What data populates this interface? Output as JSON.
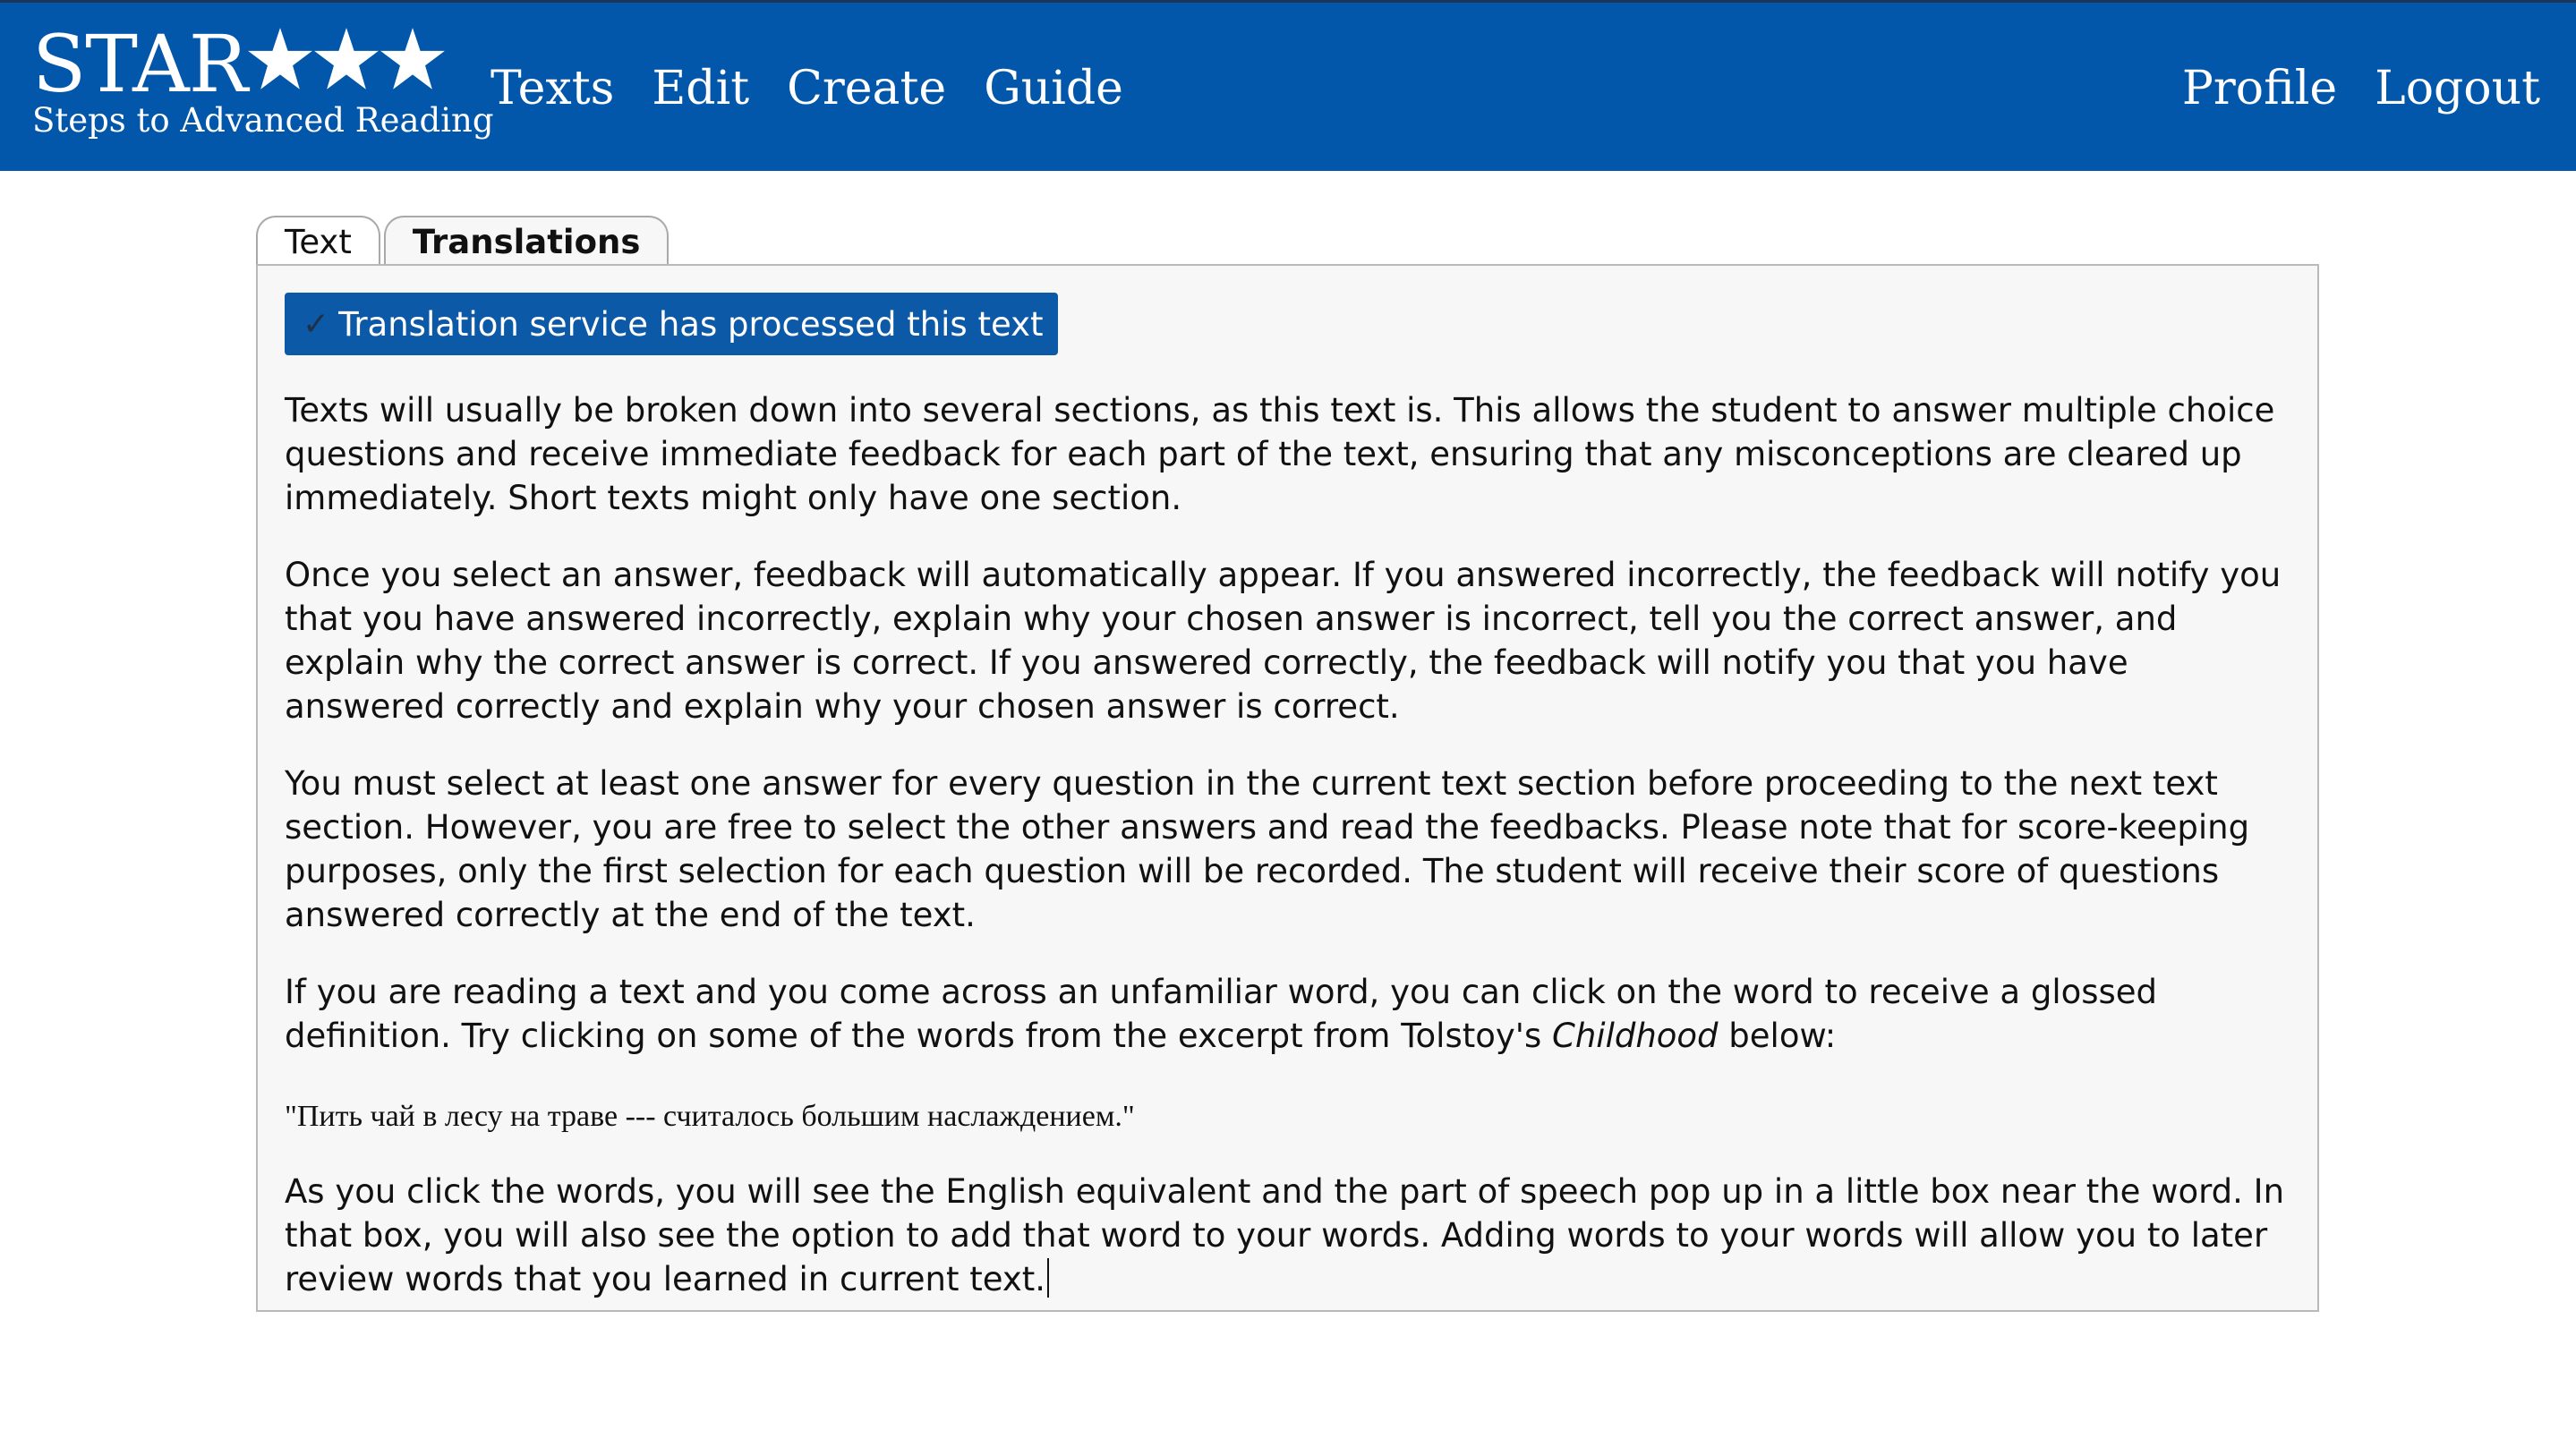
{
  "header": {
    "logo": {
      "title": "STAR",
      "subtitle": "Steps to Advanced Reading",
      "star_icon": "star-icon",
      "star_count": 3
    },
    "nav_left": [
      {
        "label": "Texts"
      },
      {
        "label": "Edit"
      },
      {
        "label": "Create"
      },
      {
        "label": "Guide"
      }
    ],
    "nav_right": [
      {
        "label": "Profile"
      },
      {
        "label": "Logout"
      }
    ],
    "colors": {
      "bar": "#0357ab",
      "text": "#ffffff"
    }
  },
  "tabs": [
    {
      "label": "Text",
      "active": false
    },
    {
      "label": "Translations",
      "active": true
    }
  ],
  "content": {
    "status": {
      "icon": "check-icon",
      "icon_glyph": "✓",
      "text": "Translation service has processed this text",
      "color": "#0c59a8"
    },
    "paragraphs": [
      {
        "text": "Texts will usually be broken down into several sections, as this text is. This allows the student to answer multiple choice questions and receive immediate feedback for each part of the text, ensuring that any misconceptions are cleared up immediately. Short texts might only have one section."
      },
      {
        "text": "Once you select an answer, feedback will automatically appear. If you answered incorrectly, the feedback will notify you that you have answered incorrectly, explain why your chosen answer is incorrect, tell you the correct answer, and explain why the correct answer is correct. If you answered correctly, the feedback will notify you that you have answered correctly and explain why your chosen answer is correct."
      },
      {
        "text": "You must select at least one answer for every question in the current text section before proceeding to the next text section. However, you are free to select the other answers and read the feedbacks. Please note that for score-keeping purposes, only the first selection for each question will be recorded. The student will receive their score of questions answered correctly at the end of the text."
      }
    ],
    "glossary_paragraph": {
      "before": "If you are reading a text and you come across an unfamiliar word, you can click on the word to receive a glossed definition. Try clicking on some of the words from the excerpt from Tolstoy's ",
      "italic": "Childhood",
      "after": " below:"
    },
    "russian_quote": "\"Пить чай в лесу на траве --- считалось большим наслаждением.\"",
    "final_paragraph": "As you click the words, you will see the English equivalent and the part of speech pop up in a little box near the word. In that box, you will also see the option to add that word to your words. Adding words to your words will allow you to later review words that you learned in current text."
  }
}
